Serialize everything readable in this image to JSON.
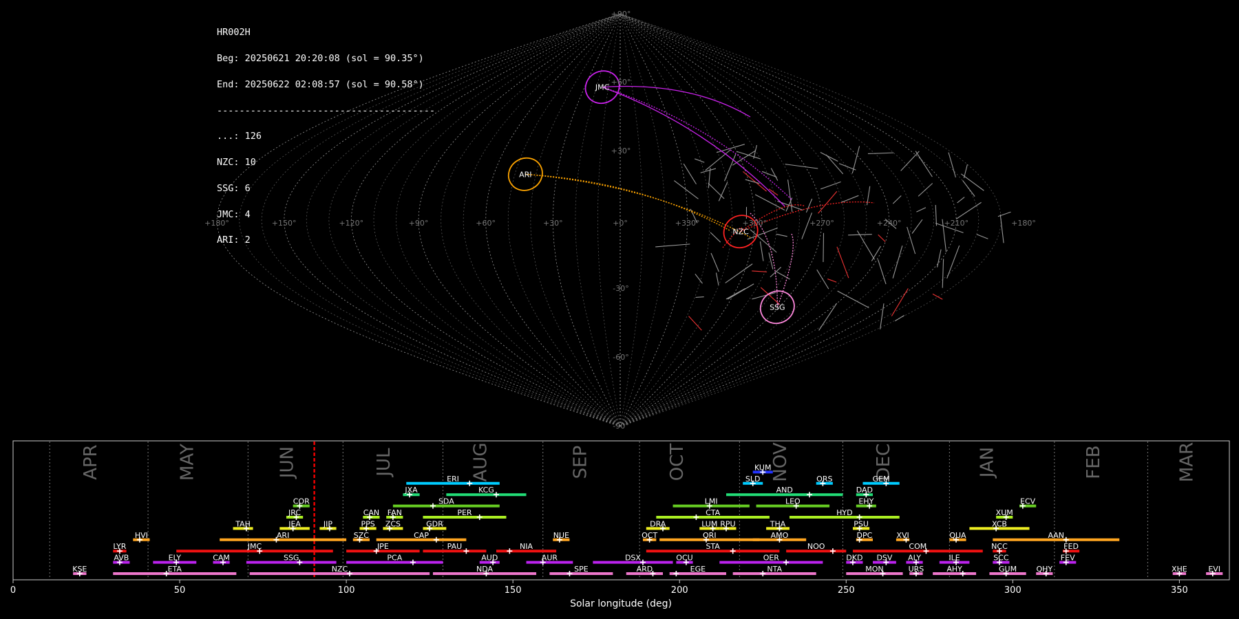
{
  "info": {
    "station": "HR002H",
    "begin": "Beg: 20250621 20:20:08 (sol = 90.35°)",
    "end": "End: 20250622 02:08:57 (sol = 90.58°)",
    "separator": "---------------------------------------",
    "counts": [
      "...: 126",
      "NZC: 10",
      "SSG: 6",
      "JMC: 4",
      "ARI: 2"
    ]
  },
  "sky_map": {
    "projection": "sinusoidal",
    "lon_labels": [
      "+180°",
      "+150°",
      "+120°",
      "+90°",
      "+60°",
      "+30°",
      "+0°",
      "+330°",
      "+300°",
      "+270°",
      "+240°",
      "+210°",
      "+180°"
    ],
    "lat_labels": [
      "+90°",
      "+60°",
      "+30°",
      "-30°",
      "-60°",
      "-90°"
    ],
    "radiants": [
      {
        "code": "JMC",
        "lon": 15,
        "lat": 58,
        "color": "#cc22ee"
      },
      {
        "code": "ARI",
        "lon": 45,
        "lat": 20,
        "color": "#ffa500"
      },
      {
        "code": "NZC",
        "lon": 306,
        "lat": -5,
        "color": "#ff2222"
      },
      {
        "code": "SSG",
        "lon": 271,
        "lat": -38,
        "color": "#ff88dd"
      }
    ]
  },
  "chart_data": {
    "type": "timeline",
    "xlabel": "Solar longitude (deg)",
    "xlim": [
      0,
      365
    ],
    "xticks": [
      0,
      50,
      100,
      150,
      200,
      250,
      300,
      350
    ],
    "month_labels": [
      {
        "name": "APR",
        "x": 25
      },
      {
        "name": "MAY",
        "x": 54
      },
      {
        "name": "JUN",
        "x": 84
      },
      {
        "name": "JUL",
        "x": 113
      },
      {
        "name": "AUG",
        "x": 142
      },
      {
        "name": "SEP",
        "x": 172
      },
      {
        "name": "OCT",
        "x": 201
      },
      {
        "name": "NOV",
        "x": 232
      },
      {
        "name": "DEC",
        "x": 263
      },
      {
        "name": "JAN",
        "x": 294
      },
      {
        "name": "FEB",
        "x": 326
      },
      {
        "name": "MAR",
        "x": 354
      }
    ],
    "month_boundaries": [
      11,
      40.5,
      70.5,
      99,
      129,
      159,
      188,
      218,
      249,
      281,
      312.5,
      340.5
    ],
    "current_sol": 90.4,
    "showers": [
      {
        "code": "KUM",
        "start": 222,
        "end": 228,
        "peak": 225,
        "row": 10,
        "color": "#2233ff"
      },
      {
        "code": "ERI",
        "start": 118,
        "end": 146,
        "peak": 137,
        "row": 9,
        "color": "#00ccff"
      },
      {
        "code": "SLD",
        "start": 219,
        "end": 225,
        "peak": 222,
        "row": 9,
        "color": "#00ccff"
      },
      {
        "code": "ORS",
        "start": 241,
        "end": 246,
        "peak": 243,
        "row": 9,
        "color": "#00ccff"
      },
      {
        "code": "GEM",
        "start": 255,
        "end": 266,
        "peak": 262,
        "row": 9,
        "color": "#00ccff"
      },
      {
        "code": "JXA",
        "start": 117,
        "end": 122,
        "peak": 119,
        "row": 8,
        "color": "#22dd77"
      },
      {
        "code": "KCG",
        "start": 130,
        "end": 154,
        "peak": 145,
        "row": 8,
        "color": "#22dd77"
      },
      {
        "code": "AND",
        "start": 214,
        "end": 249,
        "peak": 239,
        "row": 8,
        "color": "#22dd77"
      },
      {
        "code": "DAD",
        "start": 253,
        "end": 258,
        "peak": 256,
        "row": 8,
        "color": "#22dd77"
      },
      {
        "code": "COR",
        "start": 84,
        "end": 89,
        "peak": 86,
        "row": 7,
        "color": "#66cc22"
      },
      {
        "code": "SDA",
        "start": 114,
        "end": 146,
        "peak": 126,
        "row": 7,
        "color": "#66cc22"
      },
      {
        "code": "LMI",
        "start": 198,
        "end": 221,
        "peak": 209,
        "row": 7,
        "color": "#66cc22"
      },
      {
        "code": "LEO",
        "start": 223,
        "end": 245,
        "peak": 235,
        "row": 7,
        "color": "#66cc22"
      },
      {
        "code": "EHY",
        "start": 253,
        "end": 259,
        "peak": 257,
        "row": 7,
        "color": "#66cc22"
      },
      {
        "code": "ECV",
        "start": 302,
        "end": 307,
        "peak": 303,
        "row": 7,
        "color": "#66cc22"
      },
      {
        "code": "JRC",
        "start": 82,
        "end": 87,
        "peak": 85,
        "row": 6,
        "color": "#aaee22"
      },
      {
        "code": "CAN",
        "start": 105,
        "end": 110,
        "peak": 107,
        "row": 6,
        "color": "#aaee22"
      },
      {
        "code": "FAN",
        "start": 112,
        "end": 117,
        "peak": 114,
        "row": 6,
        "color": "#aaee22"
      },
      {
        "code": "PER",
        "start": 123,
        "end": 148,
        "peak": 140,
        "row": 6,
        "color": "#aaee22"
      },
      {
        "code": "CTA",
        "start": 193,
        "end": 227,
        "peak": 205,
        "row": 6,
        "color": "#aaee22"
      },
      {
        "code": "HYD",
        "start": 233,
        "end": 266,
        "peak": 254,
        "row": 6,
        "color": "#aaee22"
      },
      {
        "code": "XUM",
        "start": 295,
        "end": 300,
        "peak": 298,
        "row": 6,
        "color": "#aaee22"
      },
      {
        "code": "TAH",
        "start": 66,
        "end": 72,
        "peak": 70,
        "row": 5,
        "color": "#eeee22"
      },
      {
        "code": "JEA",
        "start": 80,
        "end": 89,
        "peak": 84,
        "row": 5,
        "color": "#eeee22"
      },
      {
        "code": "JIP",
        "start": 92,
        "end": 97,
        "peak": 95,
        "row": 5,
        "color": "#eeee22"
      },
      {
        "code": "PPS",
        "start": 104,
        "end": 109,
        "peak": 106,
        "row": 5,
        "color": "#eeee22"
      },
      {
        "code": "ZCS",
        "start": 111,
        "end": 117,
        "peak": 113,
        "row": 5,
        "color": "#eeee22"
      },
      {
        "code": "GDR",
        "start": 123,
        "end": 130,
        "peak": 125,
        "row": 5,
        "color": "#eeee22"
      },
      {
        "code": "DRA",
        "start": 190,
        "end": 197,
        "peak": 195,
        "row": 5,
        "color": "#eeee22"
      },
      {
        "code": "LUM",
        "start": 206,
        "end": 212,
        "peak": 210,
        "row": 5,
        "color": "#eeee22"
      },
      {
        "code": "RPU",
        "start": 212,
        "end": 217,
        "peak": 214,
        "row": 5,
        "color": "#eeee22"
      },
      {
        "code": "THA",
        "start": 226,
        "end": 233,
        "peak": 230,
        "row": 5,
        "color": "#eeee22"
      },
      {
        "code": "PSU",
        "start": 252,
        "end": 257,
        "peak": 254,
        "row": 5,
        "color": "#eeee22"
      },
      {
        "code": "XCB",
        "start": 287,
        "end": 305,
        "peak": 295,
        "row": 5,
        "color": "#eeee22"
      },
      {
        "code": "HVI",
        "start": 36,
        "end": 41,
        "peak": 38,
        "row": 4,
        "color": "#ffa520"
      },
      {
        "code": "ARI",
        "start": 62,
        "end": 100,
        "peak": 79,
        "row": 4,
        "color": "#ffa520"
      },
      {
        "code": "SZC",
        "start": 102,
        "end": 107,
        "peak": 104,
        "row": 4,
        "color": "#ffa520"
      },
      {
        "code": "CAP",
        "start": 109,
        "end": 136,
        "peak": 127,
        "row": 4,
        "color": "#ffa520"
      },
      {
        "code": "NUE",
        "start": 162,
        "end": 167,
        "peak": 164,
        "row": 4,
        "color": "#ffa520"
      },
      {
        "code": "OCT",
        "start": 189,
        "end": 193,
        "peak": 191,
        "row": 4,
        "color": "#ffa520"
      },
      {
        "code": "ORI",
        "start": 194,
        "end": 224,
        "peak": 208,
        "row": 4,
        "color": "#ffa520"
      },
      {
        "code": "AMO",
        "start": 222,
        "end": 238,
        "peak": 230,
        "row": 4,
        "color": "#ffa520"
      },
      {
        "code": "DPC",
        "start": 253,
        "end": 258,
        "peak": 254,
        "row": 4,
        "color": "#ffa520"
      },
      {
        "code": "XVI",
        "start": 265,
        "end": 269,
        "peak": 268,
        "row": 4,
        "color": "#ffa520"
      },
      {
        "code": "QUA",
        "start": 281,
        "end": 286,
        "peak": 283,
        "row": 4,
        "color": "#ffa520"
      },
      {
        "code": "AAN",
        "start": 294,
        "end": 332,
        "peak": 316,
        "row": 4,
        "color": "#ffa520"
      },
      {
        "code": "LYR",
        "start": 30,
        "end": 34,
        "peak": 32,
        "row": 3,
        "color": "#ee1111"
      },
      {
        "code": "JMC",
        "start": 49,
        "end": 96,
        "peak": 74,
        "row": 3,
        "color": "#ee1111"
      },
      {
        "code": "JPE",
        "start": 100,
        "end": 122,
        "peak": 109,
        "row": 3,
        "color": "#ee1111"
      },
      {
        "code": "PAU",
        "start": 123,
        "end": 142,
        "peak": 136,
        "row": 3,
        "color": "#ee1111"
      },
      {
        "code": "NIA",
        "start": 145,
        "end": 163,
        "peak": 149,
        "row": 3,
        "color": "#ee1111"
      },
      {
        "code": "STA",
        "start": 190,
        "end": 230,
        "peak": 216,
        "row": 3,
        "color": "#ee1111"
      },
      {
        "code": "NOO",
        "start": 232,
        "end": 250,
        "peak": 246,
        "row": 3,
        "color": "#ee1111"
      },
      {
        "code": "COM",
        "start": 252,
        "end": 291,
        "peak": 274,
        "row": 3,
        "color": "#ee1111"
      },
      {
        "code": "NCC",
        "start": 294,
        "end": 298,
        "peak": 296,
        "row": 3,
        "color": "#ee1111"
      },
      {
        "code": "FED",
        "start": 315,
        "end": 320,
        "peak": 316,
        "row": 3,
        "color": "#ee1111"
      },
      {
        "code": "AVB",
        "start": 30,
        "end": 35,
        "peak": 32,
        "row": 2,
        "color": "#bb22ee"
      },
      {
        "code": "ELY",
        "start": 42,
        "end": 55,
        "peak": 49,
        "row": 2,
        "color": "#bb22ee"
      },
      {
        "code": "CAM",
        "start": 60,
        "end": 65,
        "peak": 63,
        "row": 2,
        "color": "#bb22ee"
      },
      {
        "code": "SSG",
        "start": 70,
        "end": 97,
        "peak": 86,
        "row": 2,
        "color": "#bb22ee"
      },
      {
        "code": "PCA",
        "start": 100,
        "end": 129,
        "peak": 120,
        "row": 2,
        "color": "#bb22ee"
      },
      {
        "code": "AUD",
        "start": 140,
        "end": 146,
        "peak": 144,
        "row": 2,
        "color": "#bb22ee"
      },
      {
        "code": "AUR",
        "start": 154,
        "end": 168,
        "peak": 159,
        "row": 2,
        "color": "#bb22ee"
      },
      {
        "code": "DSX",
        "start": 174,
        "end": 198,
        "peak": 189,
        "row": 2,
        "color": "#bb22ee"
      },
      {
        "code": "OCU",
        "start": 199,
        "end": 204,
        "peak": 202,
        "row": 2,
        "color": "#bb22ee"
      },
      {
        "code": "OER",
        "start": 212,
        "end": 243,
        "peak": 232,
        "row": 2,
        "color": "#bb22ee"
      },
      {
        "code": "DKD",
        "start": 250,
        "end": 255,
        "peak": 252,
        "row": 2,
        "color": "#bb22ee"
      },
      {
        "code": "DSV",
        "start": 258,
        "end": 265,
        "peak": 262,
        "row": 2,
        "color": "#bb22ee"
      },
      {
        "code": "ALY",
        "start": 268,
        "end": 273,
        "peak": 271,
        "row": 2,
        "color": "#bb22ee"
      },
      {
        "code": "ILE",
        "start": 278,
        "end": 287,
        "peak": 283,
        "row": 2,
        "color": "#bb22ee"
      },
      {
        "code": "SCC",
        "start": 294,
        "end": 299,
        "peak": 296,
        "row": 2,
        "color": "#bb22ee"
      },
      {
        "code": "FEV",
        "start": 314,
        "end": 319,
        "peak": 316,
        "row": 2,
        "color": "#bb22ee"
      },
      {
        "code": "KSE",
        "start": 18,
        "end": 22,
        "peak": 20,
        "row": 1,
        "color": "#ee77cc"
      },
      {
        "code": "ETA",
        "start": 30,
        "end": 67,
        "peak": 46,
        "row": 1,
        "color": "#ee77cc"
      },
      {
        "code": "NZC",
        "start": 71,
        "end": 125,
        "peak": 101,
        "row": 1,
        "color": "#ee77cc"
      },
      {
        "code": "NDA",
        "start": 126,
        "end": 157,
        "peak": 142,
        "row": 1,
        "color": "#ee77cc"
      },
      {
        "code": "SPE",
        "start": 161,
        "end": 180,
        "peak": 167,
        "row": 1,
        "color": "#ee77cc"
      },
      {
        "code": "ARD",
        "start": 184,
        "end": 195,
        "peak": 192,
        "row": 1,
        "color": "#ee77cc"
      },
      {
        "code": "EGE",
        "start": 197,
        "end": 214,
        "peak": 199,
        "row": 1,
        "color": "#ee77cc"
      },
      {
        "code": "NTA",
        "start": 216,
        "end": 241,
        "peak": 225,
        "row": 1,
        "color": "#ee77cc"
      },
      {
        "code": "MON",
        "start": 250,
        "end": 267,
        "peak": 261,
        "row": 1,
        "color": "#ee77cc"
      },
      {
        "code": "URS",
        "start": 269,
        "end": 273,
        "peak": 271,
        "row": 1,
        "color": "#ee77cc"
      },
      {
        "code": "AHY",
        "start": 276,
        "end": 289,
        "peak": 285,
        "row": 1,
        "color": "#ee77cc"
      },
      {
        "code": "GUM",
        "start": 293,
        "end": 304,
        "peak": 298,
        "row": 1,
        "color": "#ee77cc"
      },
      {
        "code": "QHY",
        "start": 307,
        "end": 312,
        "peak": 310,
        "row": 1,
        "color": "#ee77cc"
      },
      {
        "code": "XHE",
        "start": 348,
        "end": 352,
        "peak": 350,
        "row": 1,
        "color": "#ee77cc"
      },
      {
        "code": "EVI",
        "start": 358,
        "end": 363,
        "peak": 360,
        "row": 1,
        "color": "#ee77cc"
      }
    ]
  }
}
